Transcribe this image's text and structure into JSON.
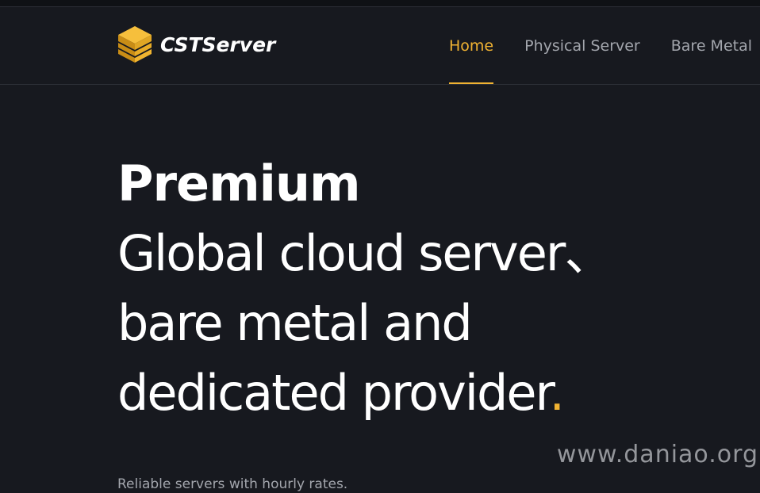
{
  "header": {
    "logo_text": "CSTServer",
    "nav": [
      {
        "label": "Home",
        "active": true
      },
      {
        "label": "Physical Server",
        "active": false
      },
      {
        "label": "Bare Metal",
        "active": false
      }
    ]
  },
  "hero": {
    "line1": "Premium",
    "line2": "Global cloud server、",
    "line3": "bare metal and",
    "line4": "dedicated provider",
    "line4_accent": ".",
    "subtitle": "Reliable servers with hourly rates."
  },
  "watermark": "www.daniao.org",
  "colors": {
    "background": "#17191f",
    "accent": "#f1b332",
    "text": "#ffffff",
    "muted_text": "#a3a6ad"
  },
  "icons": {
    "logo": "stacked-layers-icon"
  }
}
